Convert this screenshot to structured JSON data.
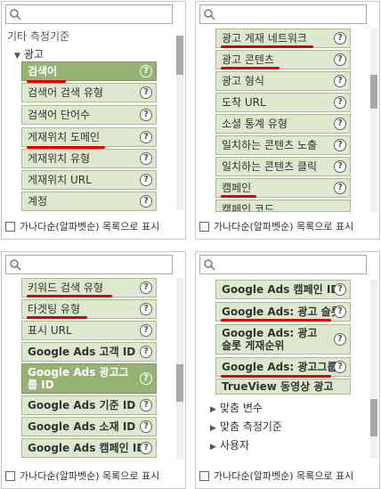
{
  "footer_label": "가나다순(알파벳순) 목록으로 표시",
  "help_glyph": "?",
  "panel1": {
    "category": "기타 측정기준",
    "group": "광고",
    "items": [
      "검색어",
      "검색어 검색 유형",
      "검색어 단어수",
      "게재위치 도메인",
      "게재위치 유형",
      "게재위치 URL",
      "계정"
    ]
  },
  "panel2": {
    "items": [
      "광고 게재 네트워크",
      "광고 콘텐츠",
      "광고 형식",
      "도착 URL",
      "소셜 통계 유형",
      "일치하는 콘텐츠 노출",
      "일치하는 콘텐츠 클릭",
      "캠페인",
      "캠페인 코드"
    ]
  },
  "panel3": {
    "items": [
      "키워드 검색 유형",
      "타겟팅 유형",
      "표시 URL",
      "Google Ads 고객 ID",
      "Google Ads 광고그룹 ID",
      "Google Ads 기준 ID",
      "Google Ads 소재 ID",
      "Google Ads 캠페인 ID"
    ]
  },
  "panel4": {
    "items": [
      "Google Ads 캠페인 ID",
      "Google Ads: 광고 슬롯",
      "Google Ads: 광고 슬롯 게재순위",
      "Google Ads: 광고그룹",
      "TrueView 동영상 광고"
    ],
    "groups": [
      "맞춤 변수",
      "맞춤 측정기준",
      "사용자"
    ]
  }
}
